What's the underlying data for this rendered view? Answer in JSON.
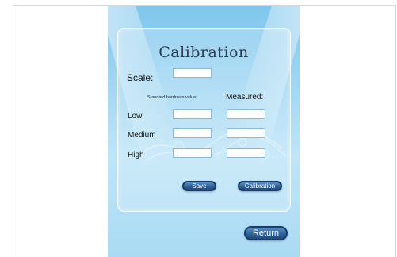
{
  "title": "Calibration",
  "scale_label": "Scale:",
  "standard_label": "Standard hardness value:",
  "measured_label": "Measured:",
  "rows": [
    {
      "label": "Low"
    },
    {
      "label": "Medium"
    },
    {
      "label": "High"
    }
  ],
  "buttons": {
    "save": "Save",
    "calibration": "Calibration",
    "return": "Return"
  },
  "colors": {
    "panel_blue": "#9fd6f3",
    "button_blue": "#2e5f97"
  }
}
